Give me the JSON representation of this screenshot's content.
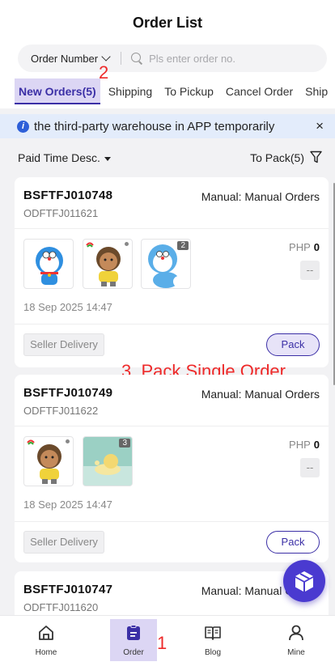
{
  "header": {
    "title": "Order List",
    "search": {
      "select_label": "Order Number",
      "placeholder": "Pls enter order no."
    },
    "tabs": [
      {
        "label": "New Orders(5)",
        "active": true
      },
      {
        "label": "Shipping"
      },
      {
        "label": "To Pickup"
      },
      {
        "label": "Cancel Order"
      },
      {
        "label": "Ship"
      }
    ]
  },
  "annotations": {
    "step1": "1",
    "step2": "2",
    "step3": "3. Pack Single Order"
  },
  "notice": {
    "icon": "i",
    "text": "the third-party warehouse in APP temporarily",
    "close": "×"
  },
  "filter": {
    "sort_label": "Paid Time Desc.",
    "to_pack_label": "To Pack(5)"
  },
  "orders": [
    {
      "order_no": "BSFTFJ010748",
      "sub_no": "ODFTFJ011621",
      "channel": "Manual: Manual Orders",
      "thumb_badge": "2",
      "currency": "PHP",
      "amount": "0",
      "qty": "--",
      "date": "18 Sep 2025 14:47",
      "delivery": "Seller Delivery",
      "pack": "Pack"
    },
    {
      "order_no": "BSFTFJ010749",
      "sub_no": "ODFTFJ011622",
      "channel": "Manual: Manual Orders",
      "thumb_badge": "3",
      "currency": "PHP",
      "amount": "0",
      "qty": "--",
      "date": "18 Sep 2025 14:47",
      "delivery": "Seller Delivery",
      "pack": "Pack"
    },
    {
      "order_no": "BSFTFJ010747",
      "sub_no": "ODFTFJ011620",
      "channel": "Manual: Manual Orders"
    }
  ],
  "bottom_nav": [
    {
      "label": "Home",
      "icon": "home-icon"
    },
    {
      "label": "Order",
      "icon": "order-icon",
      "active": true
    },
    {
      "label": "Blog",
      "icon": "book-icon"
    },
    {
      "label": "Mine",
      "icon": "user-icon"
    }
  ],
  "colors": {
    "accent": "#3b2fa6",
    "annotation": "#ee2a2a",
    "notice_bg": "#e3ecfb",
    "active_bg": "#dcd6f4"
  }
}
